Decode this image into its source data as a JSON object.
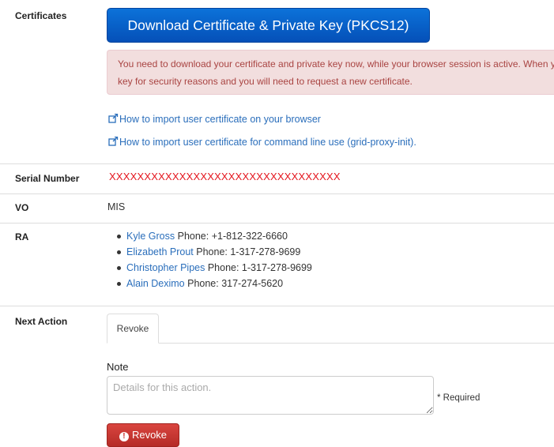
{
  "certificates": {
    "label": "Certificates",
    "download_button": "Download Certificate & Private Key (PKCS12)",
    "alert_line1": "You need to download your certificate and private key now, while your browser session is active. When y",
    "alert_line2": "key for security reasons and you will need to request a new certificate.",
    "link_browser": "How to import user certificate on your browser",
    "link_cmdline": "How to import user certificate for command line use (grid-proxy-init)."
  },
  "serial": {
    "label": "Serial Number",
    "value": "XXXXXXXXXXXXXXXXXXXXXXXXXXXXXXXXX"
  },
  "vo": {
    "label": "VO",
    "value": "MIS"
  },
  "ra": {
    "label": "RA",
    "items": [
      {
        "name": "Kyle Gross",
        "phone": " Phone: +1-812-322-6660"
      },
      {
        "name": "Elizabeth Prout",
        "phone": " Phone: 1-317-278-9699"
      },
      {
        "name": "Christopher Pipes",
        "phone": " Phone: 1-317-278-9699"
      },
      {
        "name": "Alain Deximo",
        "phone": " Phone: 317-274-5620"
      }
    ]
  },
  "next_action": {
    "label": "Next Action",
    "tab_revoke": "Revoke",
    "note_label": "Note",
    "note_placeholder": "Details for this action.",
    "required": "* Required",
    "revoke_button": "Revoke"
  },
  "colors": {
    "primary": "#0a63cc",
    "danger": "#c9302c",
    "link": "#2a6ebb",
    "alert_bg": "#f2dede",
    "alert_text": "#a94442",
    "serial_text": "#e4151d"
  },
  "icons": {
    "external_link": "external-link-icon",
    "exclamation": "exclamation-circle-icon"
  }
}
